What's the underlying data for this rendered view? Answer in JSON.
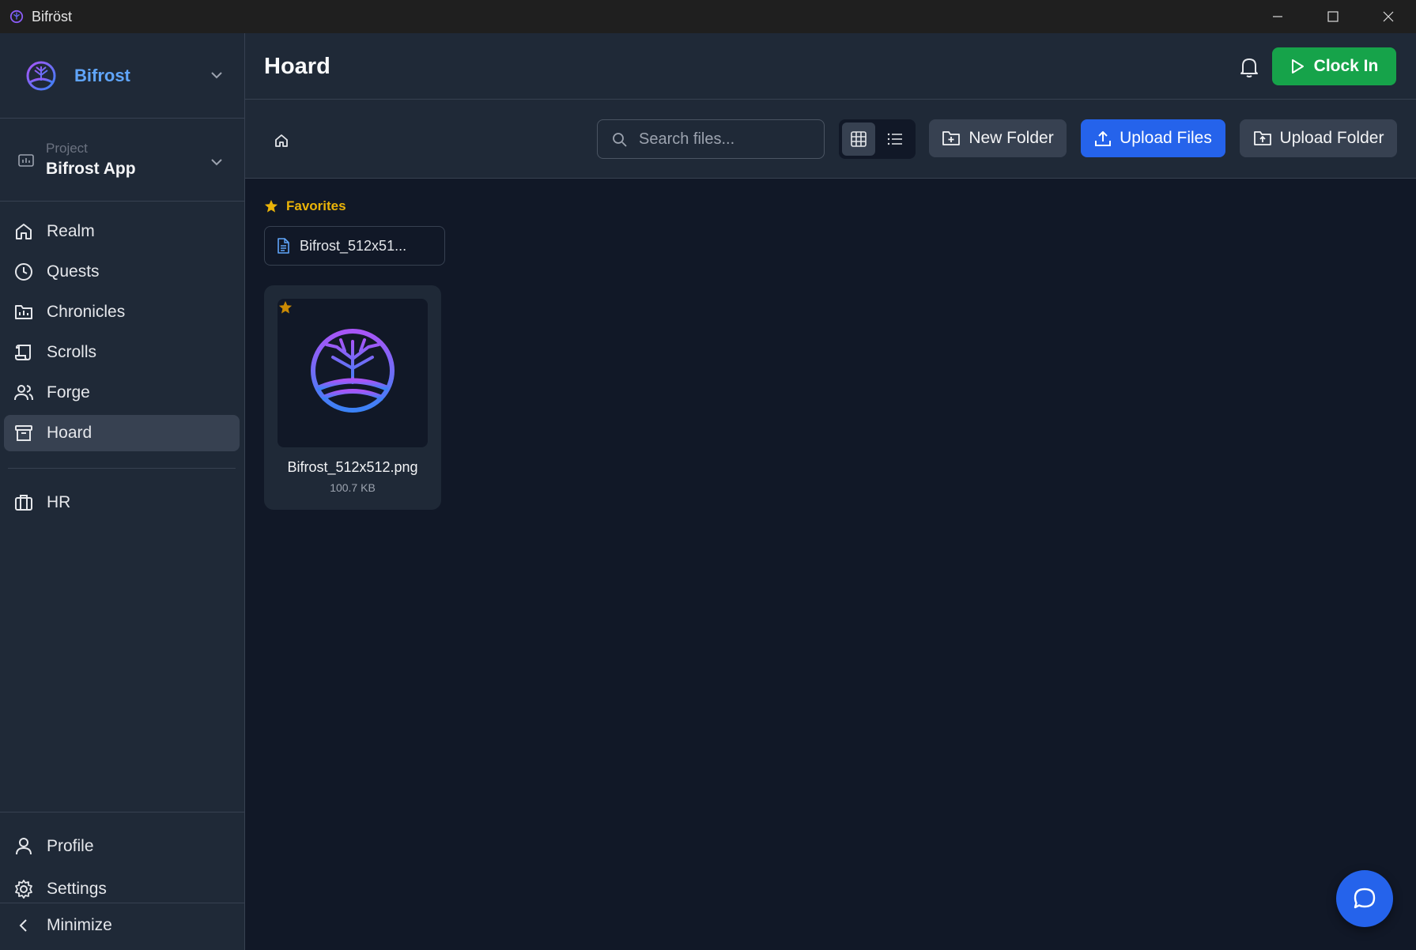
{
  "window": {
    "title": "Bifröst"
  },
  "sidebar": {
    "brand": "Bifrost",
    "project": {
      "label": "Project",
      "value": "Bifrost App"
    },
    "nav": [
      {
        "label": "Realm",
        "icon": "home-icon"
      },
      {
        "label": "Quests",
        "icon": "clock-icon"
      },
      {
        "label": "Chronicles",
        "icon": "chart-icon"
      },
      {
        "label": "Scrolls",
        "icon": "scroll-icon"
      },
      {
        "label": "Forge",
        "icon": "users-icon"
      },
      {
        "label": "Hoard",
        "icon": "archive-icon",
        "active": true
      }
    ],
    "nav2": [
      {
        "label": "HR",
        "icon": "briefcase-icon"
      }
    ],
    "bottom": {
      "profile": "Profile",
      "settings": "Settings",
      "minimize": "Minimize"
    }
  },
  "header": {
    "title": "Hoard",
    "clock_in": "Clock In"
  },
  "toolbar": {
    "search_placeholder": "Search files...",
    "new_folder": "New Folder",
    "upload_files": "Upload Files",
    "upload_folder": "Upload Folder"
  },
  "favorites": {
    "label": "Favorites",
    "items": [
      "Bifrost_512x51..."
    ]
  },
  "files": [
    {
      "name": "Bifrost_512x512.png",
      "size": "100.7 KB",
      "favorite": true
    }
  ],
  "colors": {
    "accent": "#2563eb",
    "clock": "#16a34a",
    "favorite": "#eab308",
    "brand": "#60a5fa"
  }
}
